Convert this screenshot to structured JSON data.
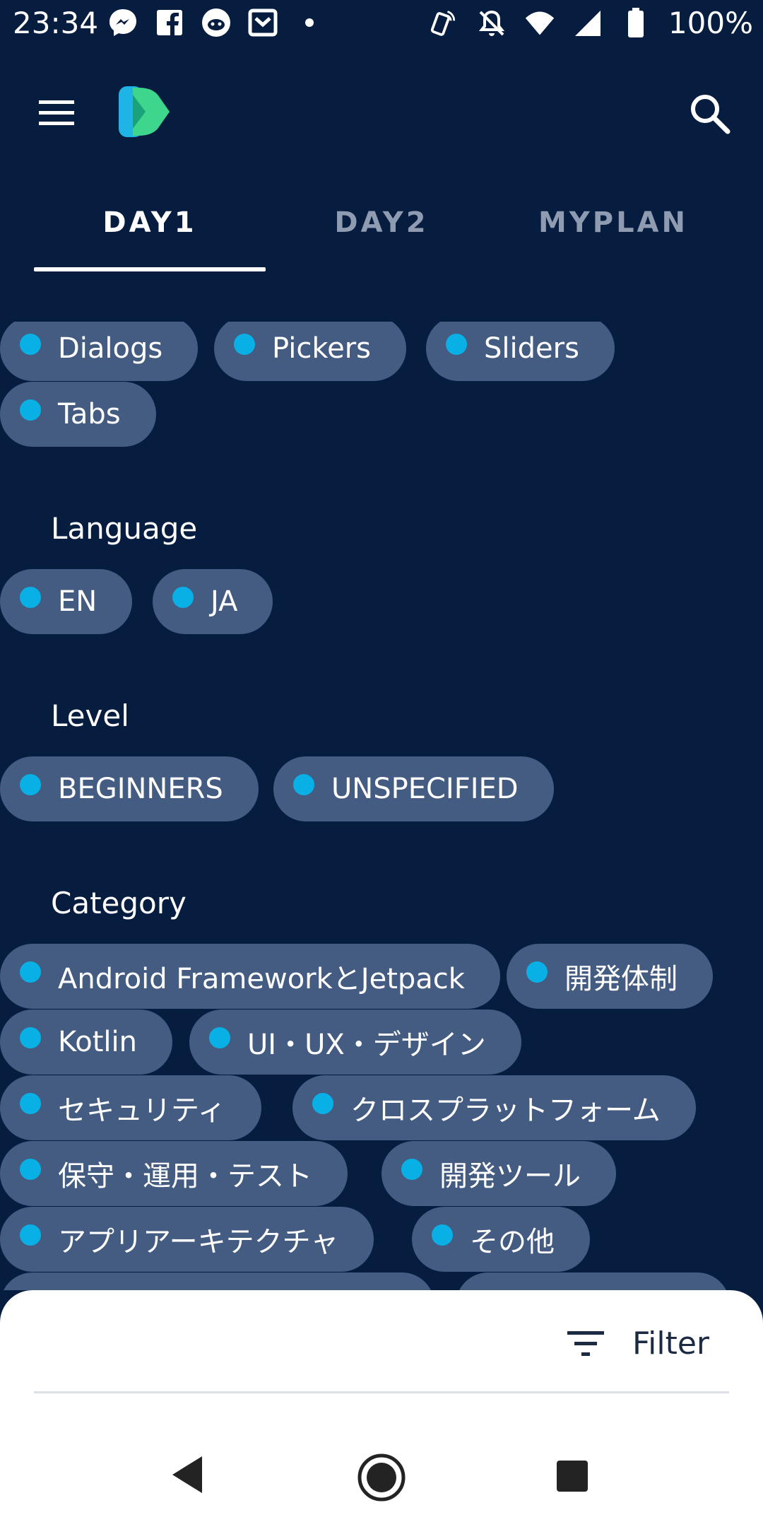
{
  "status": {
    "time": "23:34",
    "battery": "100%",
    "left_icons": [
      "messenger-icon",
      "facebook-icon",
      "reddit-icon",
      "pocket-icon",
      "dot-icon"
    ],
    "right_icons": [
      "cast-phone-icon",
      "bell-off-icon",
      "wifi-icon",
      "cellular-icon",
      "battery-icon"
    ]
  },
  "appbar": {
    "menu_icon": "hamburger-menu-icon",
    "logo_icon": "app-logo-icon",
    "search_icon": "search-icon"
  },
  "tabs": [
    {
      "label": "DAY1",
      "active": true
    },
    {
      "label": "DAY2",
      "active": false
    },
    {
      "label": "MYPLAN",
      "active": false
    }
  ],
  "filters": {
    "partial_chips": {
      "row1": [
        "Dialogs",
        "Pickers",
        "Sliders"
      ],
      "row2": [
        "Tabs"
      ]
    },
    "language": {
      "title": "Language",
      "chips": [
        "EN",
        "JA"
      ]
    },
    "level": {
      "title": "Level",
      "chips": [
        "BEGINNERS",
        "UNSPECIFIED"
      ]
    },
    "category": {
      "title": "Category",
      "chips": [
        "Android FrameworkとJetpack",
        "開発体制",
        "Kotlin",
        "UI・UX・デザイン",
        "セキュリティ",
        "クロスプラットフォーム",
        "保守・運用・テスト",
        "開発ツール",
        "アプリアーキテクチャ",
        "その他"
      ]
    }
  },
  "sheet": {
    "filter_label": "Filter",
    "filter_icon": "filter-icon"
  },
  "navbar": {
    "icons": [
      "back-icon",
      "home-icon",
      "recents-icon"
    ]
  },
  "colors": {
    "background": "#061d40",
    "chip": "#455c82",
    "chip_dot": "#08b0e6",
    "sheet": "#ffffff"
  }
}
